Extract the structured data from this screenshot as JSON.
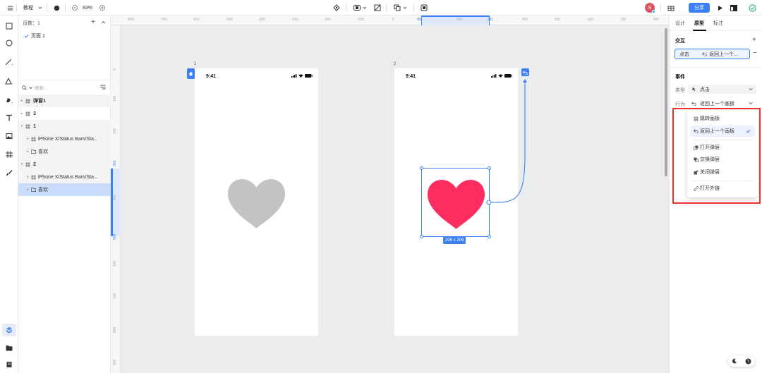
{
  "colors": {
    "accent": "#3d7ff5",
    "heart_pink": "#fe2d5f",
    "heart_grey": "#c3c3c3",
    "highlight": "#e8302c"
  },
  "topbar": {
    "file_name": "教程",
    "zoom": "83%",
    "share_label": "分享",
    "avatar_letter": "S"
  },
  "layers": {
    "page_count": "页数：1",
    "pages": [
      "页面 1"
    ],
    "search_placeholder": "搜索...",
    "items": [
      {
        "label": "弹窗1"
      },
      {
        "label": "3"
      },
      {
        "label": "1"
      },
      {
        "label": "iPhone X/Status Bars/Sta..."
      },
      {
        "label": "喜欢"
      },
      {
        "label": "2"
      },
      {
        "label": "iPhone X/Status Bars/Sta..."
      },
      {
        "label": "喜欢"
      }
    ]
  },
  "canvas": {
    "ruler_top": [
      "-800",
      "-700",
      "-600",
      "-500",
      "-400",
      "-300",
      "-200",
      "-100",
      "0",
      "85",
      "200",
      "291",
      "400",
      "500",
      "600",
      "700",
      "800"
    ],
    "ruler_left": [
      "0",
      "100",
      "200",
      "303",
      "400",
      "509",
      "600",
      "700",
      "800",
      "900"
    ],
    "frames": [
      {
        "label": "1",
        "time": "9:41"
      },
      {
        "label": "2",
        "time": "9:41"
      }
    ],
    "selection_size": "206 x 206"
  },
  "right_panel": {
    "tabs": [
      "设计",
      "原型",
      "标注"
    ],
    "interaction_title": "交互",
    "interaction_trigger": "点击",
    "interaction_action": "返回上一个...",
    "event_title": "事件",
    "type_label": "类型",
    "type_value": "点击",
    "action_label": "行为",
    "action_value": "返回上一个画板"
  },
  "action_menu": {
    "items": [
      "跳转画板",
      "返回上一个画板",
      "打开弹层",
      "交换弹层",
      "关闭弹层",
      "打开外链"
    ],
    "selected": "返回上一个画板"
  }
}
